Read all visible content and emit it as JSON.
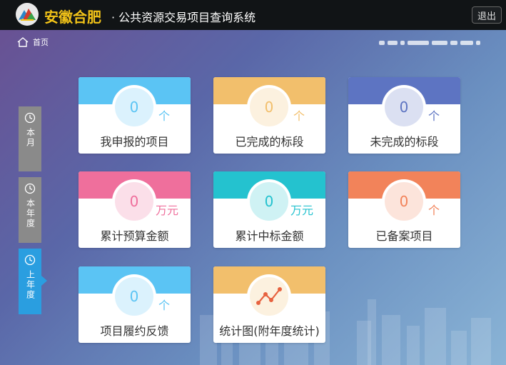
{
  "header": {
    "brand": "安徽合肥",
    "subtitle": "· 公共资源交易项目查询系统",
    "logout_label": "退出"
  },
  "breadcrumb": {
    "home_label": "首页"
  },
  "period_tabs": [
    {
      "label": "本月",
      "active": false
    },
    {
      "label": "本年度",
      "active": false
    },
    {
      "label": "上年度",
      "active": true
    }
  ],
  "cards": [
    {
      "value": "0",
      "unit": "个",
      "title": "我申报的项目",
      "color": "#5bc4f4"
    },
    {
      "value": "0",
      "unit": "个",
      "title": "已完成的标段",
      "color": "#f2bf6c"
    },
    {
      "value": "0",
      "unit": "个",
      "title": "未完成的标段",
      "color": "#5d74c2"
    },
    {
      "value": "0",
      "unit": "万元",
      "title": "累计预算金额",
      "color": "#ef6f9c"
    },
    {
      "value": "0",
      "unit": "万元",
      "title": "累计中标金额",
      "color": "#24c2cf"
    },
    {
      "value": "0",
      "unit": "个",
      "title": "已备案项目",
      "color": "#f2835a"
    },
    {
      "value": "0",
      "unit": "个",
      "title": "项目履约反馈",
      "color": "#5bc4f4"
    },
    {
      "value": "",
      "unit": "",
      "title": "统计图(附年度统计)",
      "color": "#f2bf6c"
    }
  ]
}
